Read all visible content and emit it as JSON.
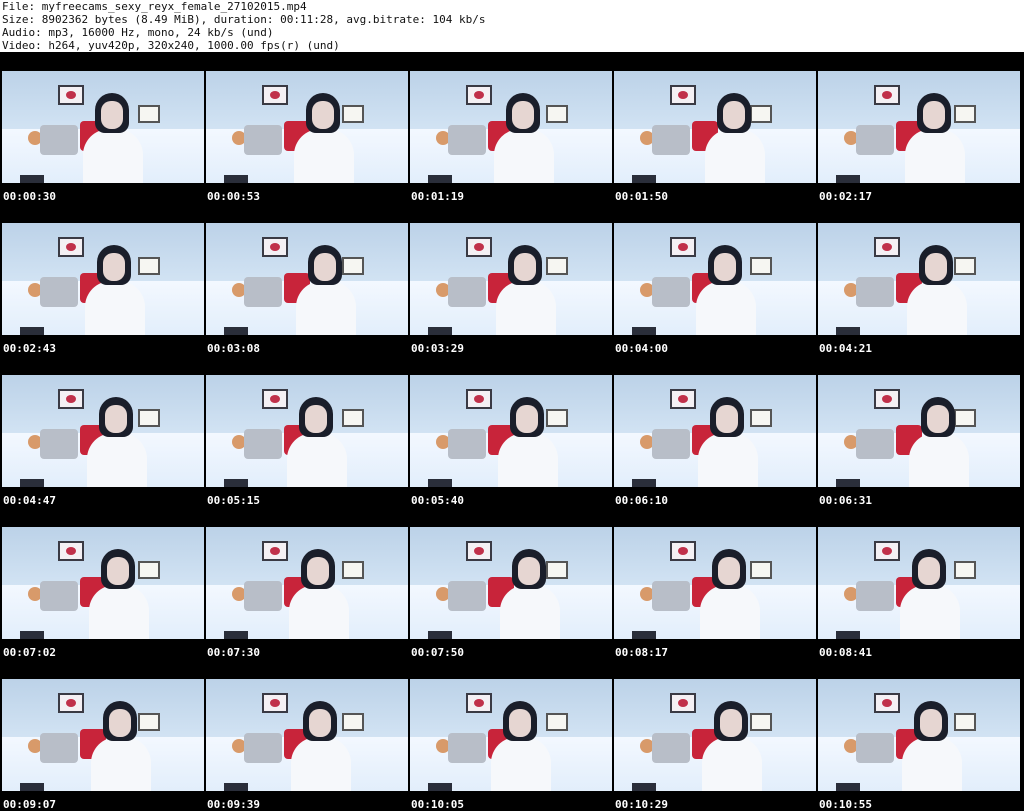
{
  "header": {
    "line1": "File: myfreecams_sexy_reyx_female_27102015.mp4",
    "line2": "Size: 8902362 bytes (8.49 MiB), duration: 00:11:28, avg.bitrate: 104 kb/s",
    "line3": "Audio: mp3, 16000 Hz, mono, 24 kb/s (und)",
    "line4": "Video: h264, yuv420p, 320x240, 1000.00 fps(r) (und)"
  },
  "thumbnails": [
    {
      "timestamp": "00:00:30"
    },
    {
      "timestamp": "00:00:53"
    },
    {
      "timestamp": "00:01:19"
    },
    {
      "timestamp": "00:01:50"
    },
    {
      "timestamp": "00:02:17"
    },
    {
      "timestamp": "00:02:43"
    },
    {
      "timestamp": "00:03:08"
    },
    {
      "timestamp": "00:03:29"
    },
    {
      "timestamp": "00:04:00"
    },
    {
      "timestamp": "00:04:21"
    },
    {
      "timestamp": "00:04:47"
    },
    {
      "timestamp": "00:05:15"
    },
    {
      "timestamp": "00:05:40"
    },
    {
      "timestamp": "00:06:10"
    },
    {
      "timestamp": "00:06:31"
    },
    {
      "timestamp": "00:07:02"
    },
    {
      "timestamp": "00:07:30"
    },
    {
      "timestamp": "00:07:50"
    },
    {
      "timestamp": "00:08:17"
    },
    {
      "timestamp": "00:08:41"
    },
    {
      "timestamp": "00:09:07"
    },
    {
      "timestamp": "00:09:39"
    },
    {
      "timestamp": "00:10:05"
    },
    {
      "timestamp": "00:10:29"
    },
    {
      "timestamp": "00:10:55"
    }
  ]
}
